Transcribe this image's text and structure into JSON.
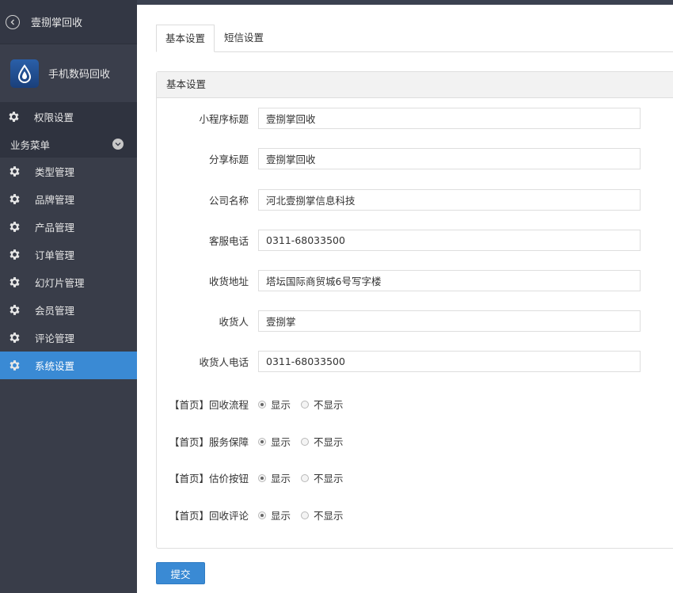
{
  "sidebar": {
    "back_title": "壹捌掌回收",
    "app_name": "手机数码回收",
    "permissions_label": "权限设置",
    "group_label": "业务菜单",
    "items": [
      {
        "label": "类型管理"
      },
      {
        "label": "品牌管理"
      },
      {
        "label": "产品管理"
      },
      {
        "label": "订单管理"
      },
      {
        "label": "幻灯片管理"
      },
      {
        "label": "会员管理"
      },
      {
        "label": "评论管理"
      },
      {
        "label": "系统设置",
        "active": true
      }
    ]
  },
  "tabs": [
    {
      "label": "基本设置",
      "active": true
    },
    {
      "label": "短信设置",
      "active": false
    }
  ],
  "panel": {
    "title": "基本设置",
    "fields": [
      {
        "label": "小程序标题",
        "value": "壹捌掌回收"
      },
      {
        "label": "分享标题",
        "value": "壹捌掌回收"
      },
      {
        "label": "公司名称",
        "value": "河北壹捌掌信息科技"
      },
      {
        "label": "客服电话",
        "value": "0311-68033500"
      },
      {
        "label": "收货地址",
        "value": "塔坛国际商贸城6号写字楼"
      },
      {
        "label": "收货人",
        "value": "壹捌掌"
      },
      {
        "label": "收货人电话",
        "value": "0311-68033500"
      }
    ],
    "toggles": [
      {
        "label": "【首页】回收流程",
        "show": "显示",
        "hide": "不显示",
        "selected": "show"
      },
      {
        "label": "【首页】服务保障",
        "show": "显示",
        "hide": "不显示",
        "selected": "show"
      },
      {
        "label": "【首页】估价按钮",
        "show": "显示",
        "hide": "不显示",
        "selected": "show"
      },
      {
        "label": "【首页】回收评论",
        "show": "显示",
        "hide": "不显示",
        "selected": "show"
      }
    ]
  },
  "submit_label": "提交",
  "colors": {
    "sidebar_bg": "#393d49",
    "accent": "#3a8ad4"
  }
}
